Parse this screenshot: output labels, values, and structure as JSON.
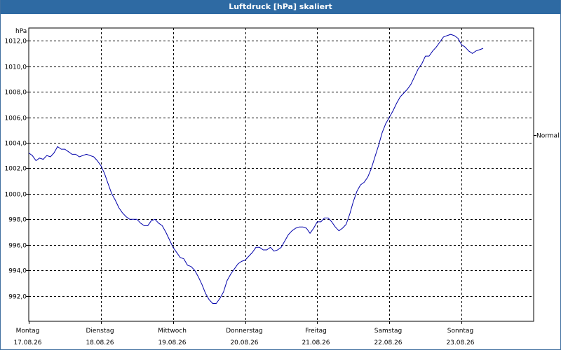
{
  "window": {
    "title": "Luftdruck [hPa] skaliert"
  },
  "chart_data": {
    "type": "line",
    "title": "Luftdruck [hPa] skaliert",
    "ylabel": "hPa",
    "ylim": [
      990.0,
      1013.0
    ],
    "y_ticks": [
      "992,0",
      "994,0",
      "996,0",
      "998,0",
      "1000,0",
      "1002,0",
      "1004,0",
      "1006,0",
      "1008,0",
      "1010,0",
      "1012,0"
    ],
    "x_range_days": [
      0,
      7
    ],
    "x_ticks": [
      {
        "day": "Montag",
        "date": "17.08.26"
      },
      {
        "day": "Dienstag",
        "date": "18.08.26"
      },
      {
        "day": "Mittwoch",
        "date": "19.08.26"
      },
      {
        "day": "Donnerstag",
        "date": "20.08.26"
      },
      {
        "day": "Freitag",
        "date": "21.08.26"
      },
      {
        "day": "Samstag",
        "date": "22.08.26"
      },
      {
        "day": "Sonntag",
        "date": "23.08.26"
      }
    ],
    "reference_line": {
      "label": "Normal",
      "value": 1004.6
    },
    "grid": true,
    "series": [
      {
        "color": "#0000aa",
        "points": [
          [
            0.0,
            1003.2
          ],
          [
            0.05,
            1003.0
          ],
          [
            0.1,
            1002.6
          ],
          [
            0.15,
            1002.8
          ],
          [
            0.2,
            1002.7
          ],
          [
            0.25,
            1003.0
          ],
          [
            0.3,
            1002.9
          ],
          [
            0.35,
            1003.2
          ],
          [
            0.4,
            1003.7
          ],
          [
            0.45,
            1003.5
          ],
          [
            0.5,
            1003.5
          ],
          [
            0.55,
            1003.3
          ],
          [
            0.6,
            1003.1
          ],
          [
            0.65,
            1003.1
          ],
          [
            0.7,
            1002.9
          ],
          [
            0.75,
            1003.0
          ],
          [
            0.8,
            1003.1
          ],
          [
            0.85,
            1003.0
          ],
          [
            0.9,
            1002.9
          ],
          [
            0.95,
            1002.6
          ],
          [
            1.0,
            1002.2
          ],
          [
            1.05,
            1001.6
          ],
          [
            1.1,
            1000.8
          ],
          [
            1.15,
            1000.0
          ],
          [
            1.2,
            999.5
          ],
          [
            1.25,
            998.9
          ],
          [
            1.3,
            998.5
          ],
          [
            1.35,
            998.2
          ],
          [
            1.4,
            998.0
          ],
          [
            1.45,
            998.0
          ],
          [
            1.5,
            998.0
          ],
          [
            1.55,
            997.7
          ],
          [
            1.6,
            997.5
          ],
          [
            1.65,
            997.5
          ],
          [
            1.7,
            997.9
          ],
          [
            1.75,
            998.0
          ],
          [
            1.8,
            997.7
          ],
          [
            1.85,
            997.5
          ],
          [
            1.9,
            997.0
          ],
          [
            1.95,
            996.4
          ],
          [
            2.0,
            995.8
          ],
          [
            2.05,
            995.4
          ],
          [
            2.1,
            995.0
          ],
          [
            2.15,
            994.9
          ],
          [
            2.2,
            994.4
          ],
          [
            2.25,
            994.3
          ],
          [
            2.3,
            994.0
          ],
          [
            2.35,
            993.5
          ],
          [
            2.4,
            992.9
          ],
          [
            2.45,
            992.2
          ],
          [
            2.5,
            991.7
          ],
          [
            2.55,
            991.4
          ],
          [
            2.6,
            991.4
          ],
          [
            2.65,
            991.8
          ],
          [
            2.7,
            992.3
          ],
          [
            2.75,
            993.2
          ],
          [
            2.8,
            993.7
          ],
          [
            2.85,
            994.1
          ],
          [
            2.9,
            994.5
          ],
          [
            2.95,
            994.7
          ],
          [
            3.0,
            994.8
          ],
          [
            3.05,
            995.1
          ],
          [
            3.1,
            995.4
          ],
          [
            3.15,
            995.8
          ],
          [
            3.2,
            995.8
          ],
          [
            3.25,
            995.6
          ],
          [
            3.3,
            995.6
          ],
          [
            3.35,
            995.8
          ],
          [
            3.4,
            995.5
          ],
          [
            3.45,
            995.6
          ],
          [
            3.5,
            995.8
          ],
          [
            3.55,
            996.3
          ],
          [
            3.6,
            996.8
          ],
          [
            3.65,
            997.1
          ],
          [
            3.7,
            997.3
          ],
          [
            3.75,
            997.4
          ],
          [
            3.8,
            997.4
          ],
          [
            3.85,
            997.3
          ],
          [
            3.9,
            996.9
          ],
          [
            3.95,
            997.3
          ],
          [
            4.0,
            997.8
          ],
          [
            4.05,
            997.8
          ],
          [
            4.1,
            998.1
          ],
          [
            4.15,
            998.1
          ],
          [
            4.2,
            997.8
          ],
          [
            4.25,
            997.4
          ],
          [
            4.3,
            997.1
          ],
          [
            4.35,
            997.3
          ],
          [
            4.4,
            997.6
          ],
          [
            4.45,
            998.4
          ],
          [
            4.5,
            999.4
          ],
          [
            4.55,
            1000.2
          ],
          [
            4.6,
            1000.7
          ],
          [
            4.65,
            1000.9
          ],
          [
            4.7,
            1001.3
          ],
          [
            4.75,
            1002.0
          ],
          [
            4.8,
            1002.9
          ],
          [
            4.85,
            1003.8
          ],
          [
            4.9,
            1004.8
          ],
          [
            4.95,
            1005.5
          ],
          [
            5.0,
            1006.0
          ],
          [
            5.05,
            1006.5
          ],
          [
            5.1,
            1007.1
          ],
          [
            5.15,
            1007.6
          ],
          [
            5.2,
            1007.9
          ],
          [
            5.25,
            1008.2
          ],
          [
            5.3,
            1008.6
          ],
          [
            5.35,
            1009.2
          ],
          [
            5.4,
            1009.8
          ],
          [
            5.45,
            1010.2
          ],
          [
            5.5,
            1010.8
          ],
          [
            5.55,
            1010.8
          ],
          [
            5.6,
            1011.2
          ],
          [
            5.65,
            1011.5
          ],
          [
            5.7,
            1011.9
          ],
          [
            5.75,
            1012.3
          ],
          [
            5.8,
            1012.4
          ],
          [
            5.85,
            1012.5
          ],
          [
            5.9,
            1012.4
          ],
          [
            5.95,
            1012.2
          ],
          [
            6.0,
            1011.7
          ],
          [
            6.05,
            1011.5
          ],
          [
            6.1,
            1011.2
          ],
          [
            6.15,
            1011.0
          ],
          [
            6.2,
            1011.2
          ],
          [
            6.25,
            1011.3
          ],
          [
            6.3,
            1011.4
          ]
        ]
      }
    ]
  }
}
